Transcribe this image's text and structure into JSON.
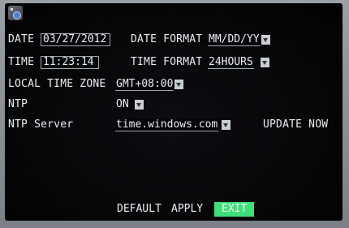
{
  "date": {
    "label": "DATE",
    "value": "03/27/2012"
  },
  "date_format": {
    "label": "DATE FORMAT",
    "value": "MM/DD/YY"
  },
  "time": {
    "label": "TIME",
    "value": "11:23:14"
  },
  "time_format": {
    "label": "TIME FORMAT",
    "value": "24HOURS"
  },
  "time_zone": {
    "label": "LOCAL TIME ZONE",
    "value": "GMT+08:00"
  },
  "ntp": {
    "label": "NTP",
    "value": "ON"
  },
  "ntp_server": {
    "label": "NTP Server",
    "value": "time.windows.com",
    "update_label": "UPDATE NOW"
  },
  "buttons": {
    "default": "DEFAULT",
    "apply": "APPLY",
    "exit": "EXIT"
  },
  "colors": {
    "exit_button": "#3ee07a",
    "screen_bg": "#050507",
    "text": "#e9eef2"
  },
  "icons": {
    "logo": "system-clock-icon",
    "dropdown": "chevron-down-icon"
  }
}
